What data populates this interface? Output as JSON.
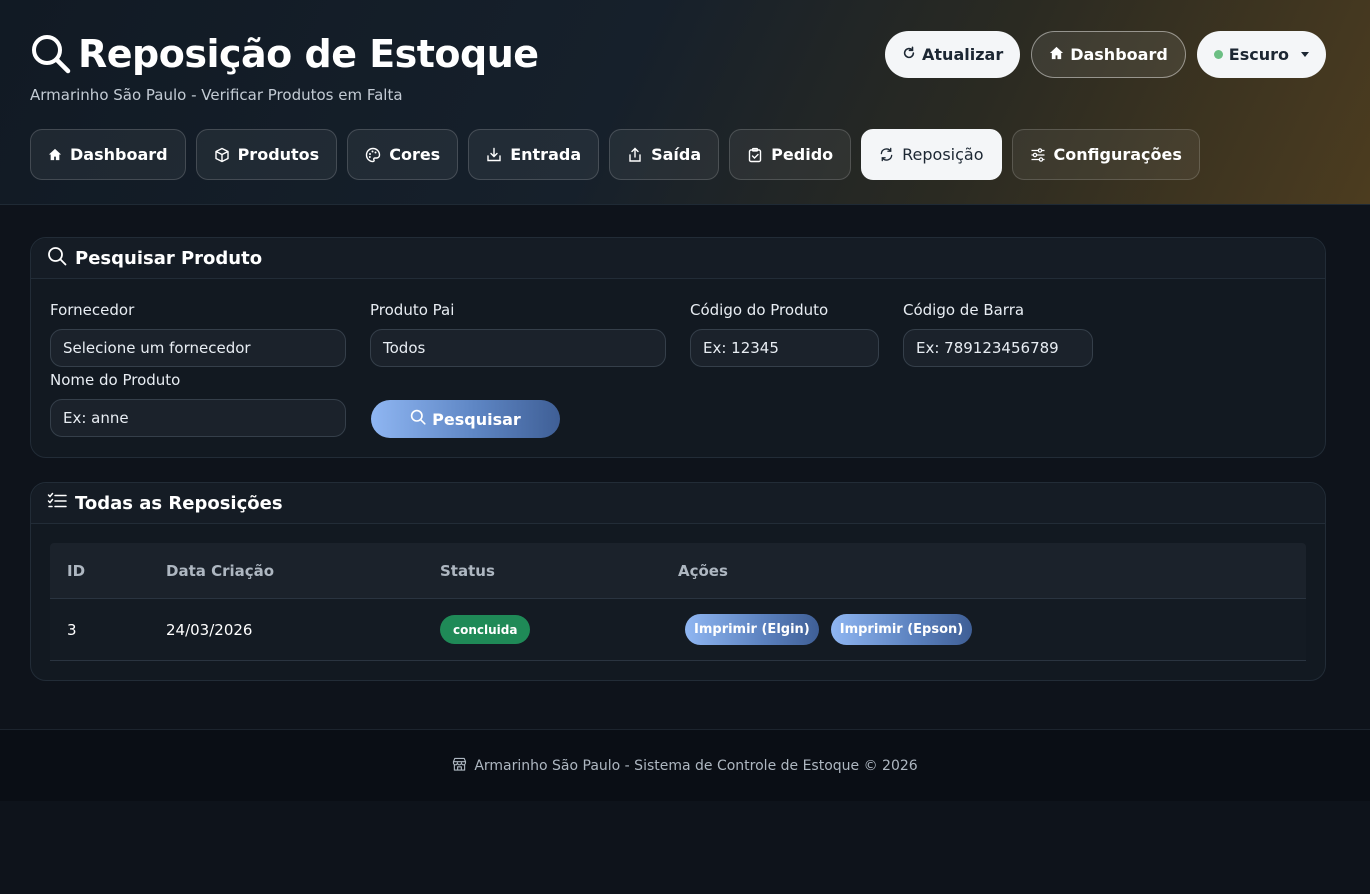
{
  "header": {
    "title": "Reposição de Estoque",
    "subtitle": "Armarinho São Paulo - Verificar Produtos em Falta",
    "actions": {
      "refresh": "Atualizar",
      "dashboard": "Dashboard",
      "theme": "Escuro"
    }
  },
  "nav": {
    "items": [
      {
        "label": "Dashboard",
        "icon": "home-icon"
      },
      {
        "label": "Produtos",
        "icon": "box-icon"
      },
      {
        "label": "Cores",
        "icon": "palette-icon"
      },
      {
        "label": "Entrada",
        "icon": "inbox-in-icon"
      },
      {
        "label": "Saída",
        "icon": "upload-icon"
      },
      {
        "label": "Pedido",
        "icon": "clipboard-check-icon"
      },
      {
        "label": "Reposição",
        "icon": "refresh-icon",
        "active": true
      },
      {
        "label": "Configurações",
        "icon": "sliders-icon"
      }
    ]
  },
  "search": {
    "title": "Pesquisar Produto",
    "fornecedor": {
      "label": "Fornecedor",
      "value": "Selecione um fornecedor"
    },
    "produto_pai": {
      "label": "Produto Pai",
      "value": "Todos"
    },
    "codigo": {
      "label": "Código do Produto",
      "placeholder": "Ex: 12345"
    },
    "codigo_barra": {
      "label": "Código de Barra",
      "placeholder": "Ex: 789123456789"
    },
    "nome": {
      "label": "Nome do Produto",
      "placeholder": "Ex: anne"
    },
    "button": "Pesquisar"
  },
  "reposicoes": {
    "title": "Todas as Reposições",
    "columns": [
      "ID",
      "Data Criação",
      "Status",
      "Ações"
    ],
    "rows": [
      {
        "id": "3",
        "data": "24/03/2026",
        "status": "concluida",
        "actions": [
          "Imprimir (Elgin)",
          "Imprimir (Epson)"
        ]
      }
    ]
  },
  "footer": {
    "text": "Armarinho São Paulo - Sistema de Controle de Estoque © 2026"
  },
  "colors": {
    "accent": "#5e86c4",
    "status_success": "#1f8a57",
    "theme_dot": "#6cbf84"
  }
}
